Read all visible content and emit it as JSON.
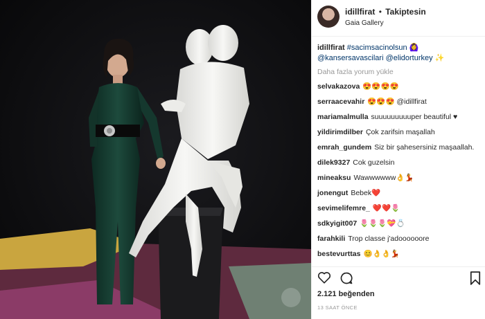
{
  "header": {
    "username": "idillfirat",
    "separator": "•",
    "follow_status": "Takiptesin",
    "location": "Gaia Gallery"
  },
  "caption": {
    "username": "idillfirat",
    "hashtag": "#sacimsacinolsun",
    "emoji1": "🙆‍♀️",
    "mention1": "@kansersavascilari",
    "mention2": "@elidorturkey",
    "emoji2": "✨"
  },
  "load_more": "Daha fazla yorum yükle",
  "comments": [
    {
      "user": "selvakazova",
      "text": "😍😍😍😍"
    },
    {
      "user": "serraacevahir",
      "text": "😍😍😍 @idillfirat"
    },
    {
      "user": "mariamalmulla",
      "text": "suuuuuuuuuper beautiful ♥"
    },
    {
      "user": "yildirimdilber",
      "text": "Çok zarifsin maşallah"
    },
    {
      "user": "emrah_gundem",
      "text": "Siz bir şahesersiniz maşaallah."
    },
    {
      "user": "dilek9327",
      "text": "Cok guzelsin"
    },
    {
      "user": "mineaksu",
      "text": "Wawwwwww👌💃"
    },
    {
      "user": "jonengut",
      "text": "Bebek❤️"
    },
    {
      "user": "sevimelifemre_",
      "text": "❤️❤️🌷"
    },
    {
      "user": "sdkyigit007",
      "text": "🌷🌷🌷💝💍"
    },
    {
      "user": "farahkili",
      "text": "Trop classe j'adoooooore"
    },
    {
      "user": "bestevurttas",
      "text": "😊👌👌💃"
    }
  ],
  "likes": "2.121 beğenden",
  "time_ago": "13 SAAT ÖNCE",
  "colors": {
    "link": "#003569",
    "muted": "#999999",
    "heart": "#ed4956"
  },
  "icons": [
    "heart-icon",
    "comment-icon",
    "bookmark-icon"
  ]
}
